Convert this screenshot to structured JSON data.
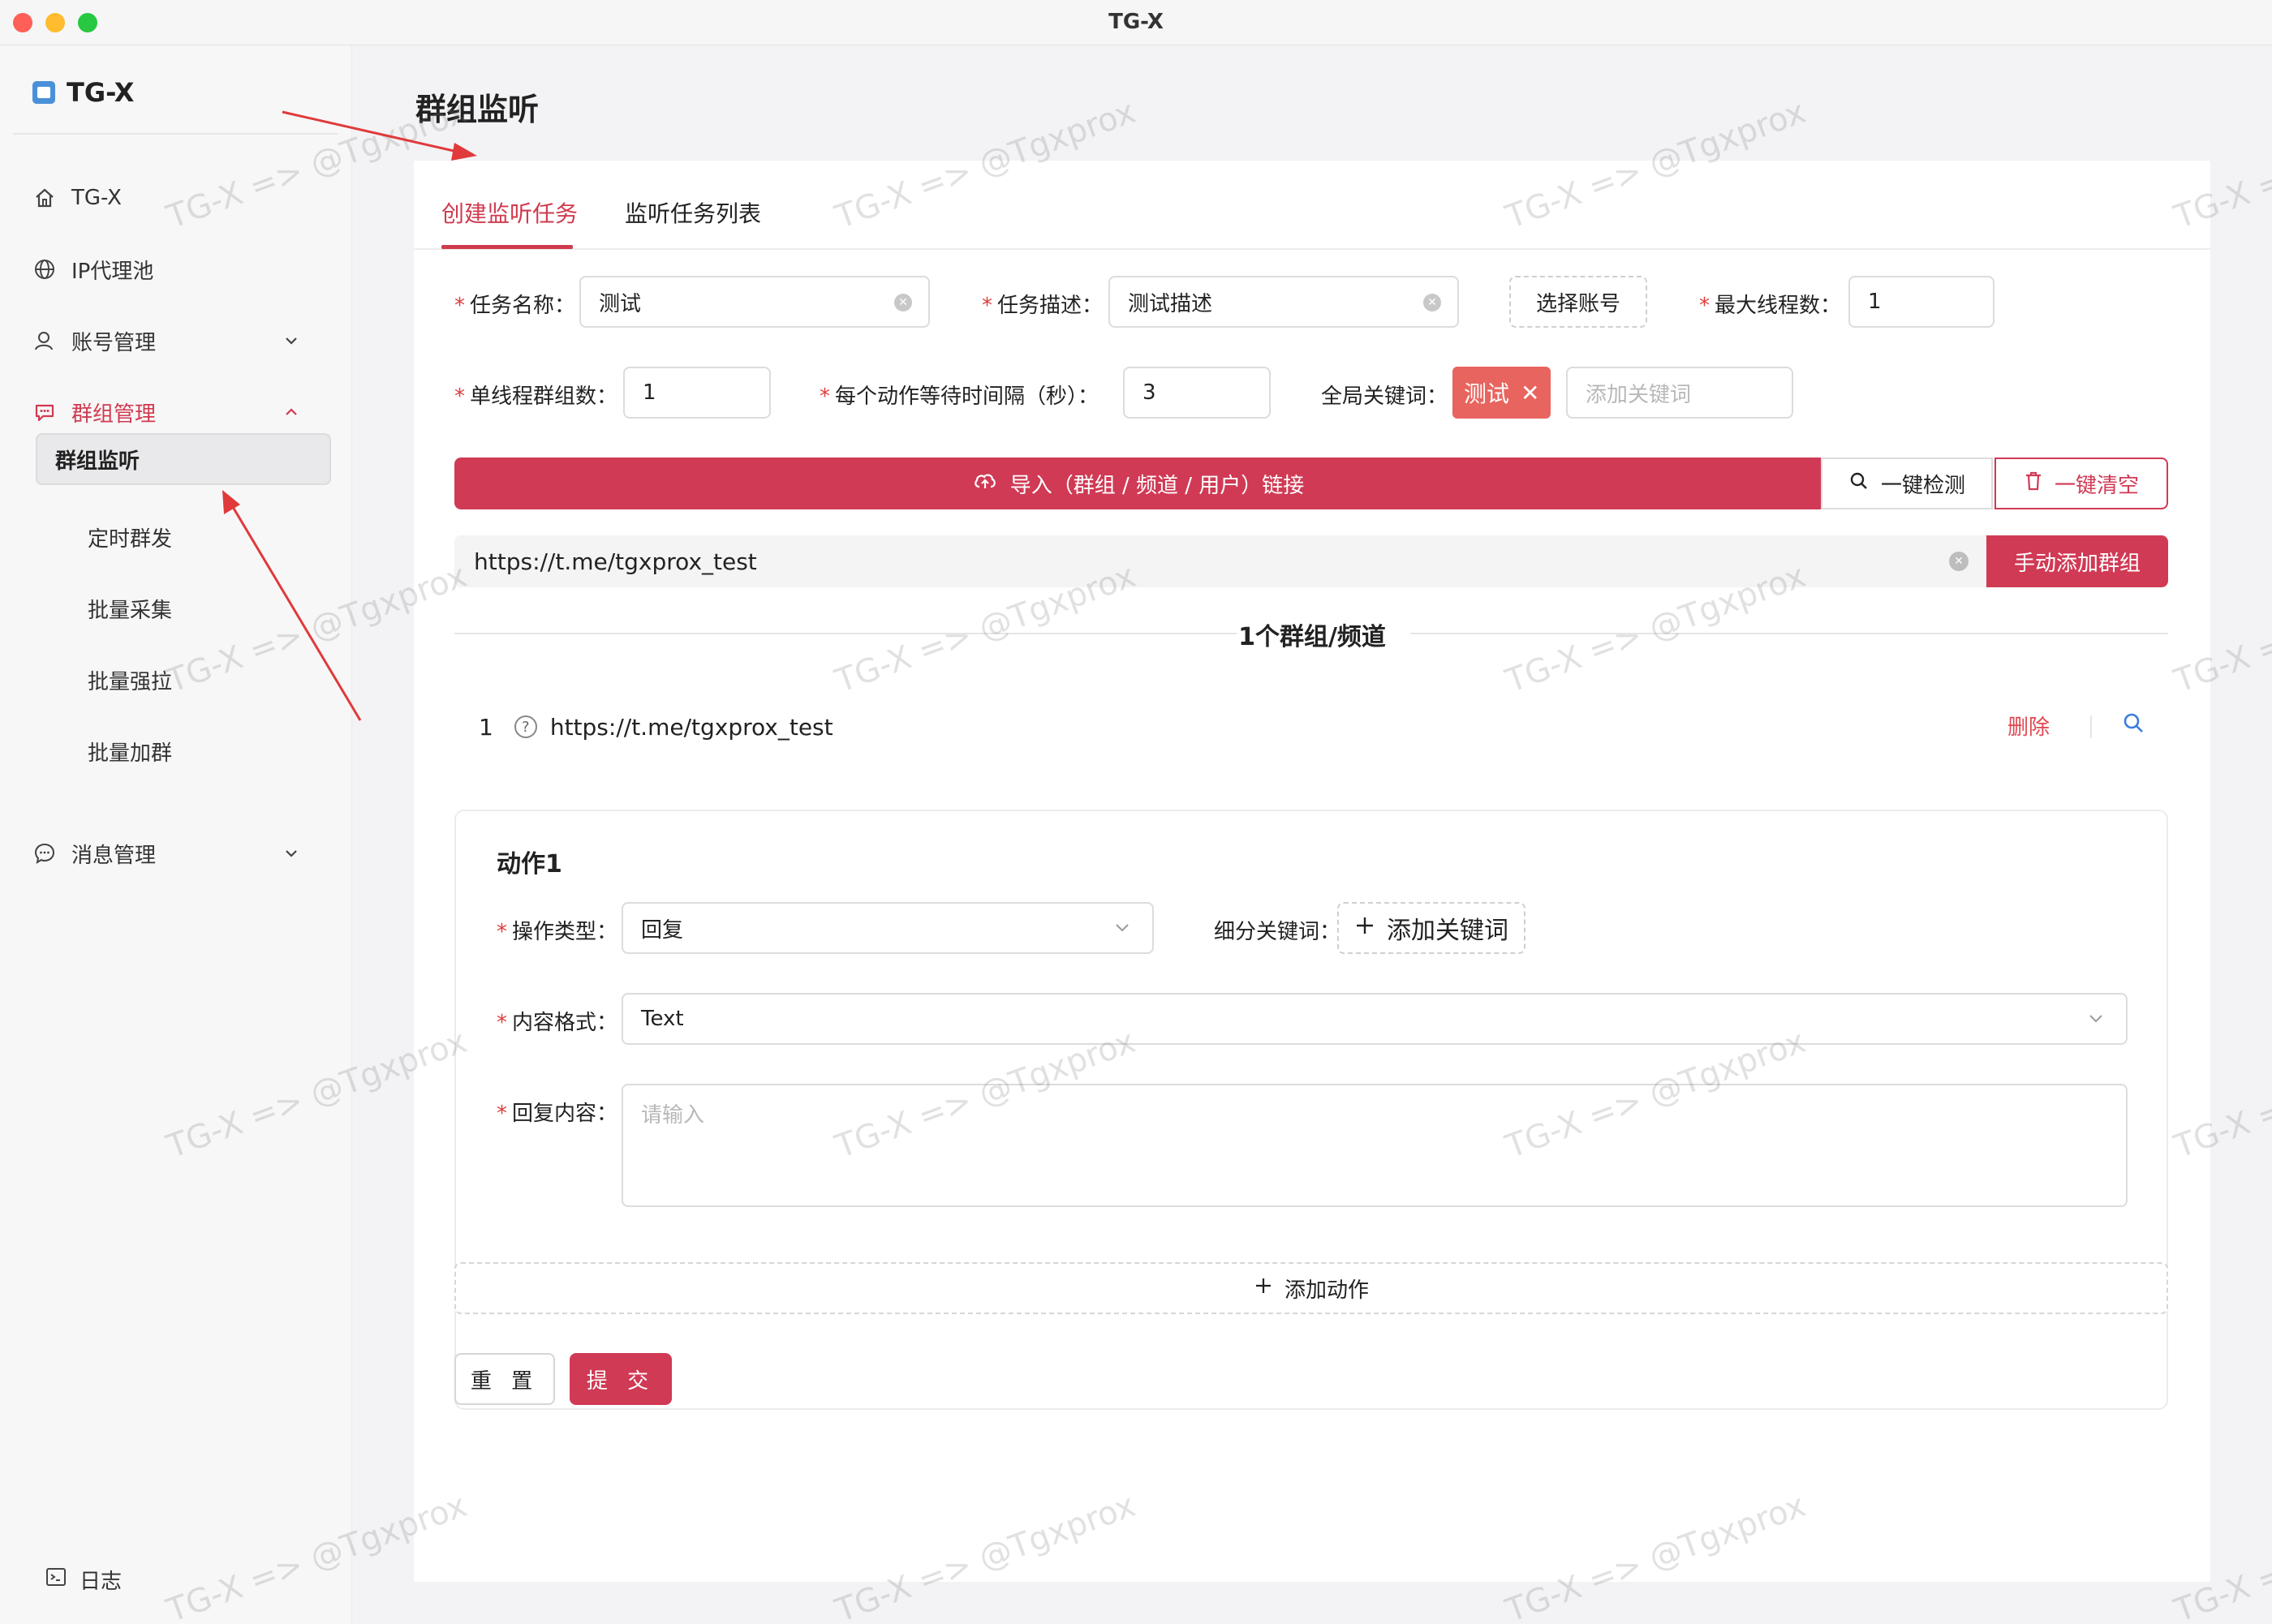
{
  "window": {
    "title": "TG-X"
  },
  "sidebar": {
    "app_name": "TG-X",
    "items": [
      {
        "label": "TG-X",
        "icon": "home-icon"
      },
      {
        "label": "IP代理池",
        "icon": "globe-icon"
      },
      {
        "label": "账号管理",
        "icon": "user-icon",
        "chevron": "down"
      },
      {
        "label": "群组管理",
        "icon": "chat-icon",
        "chevron": "up",
        "active": true
      },
      {
        "label": "消息管理",
        "icon": "message-icon",
        "chevron": "down"
      }
    ],
    "sub_items": [
      "群组监听",
      "定时群发",
      "批量采集",
      "批量强拉",
      "批量加群"
    ],
    "selected_sub": "群组监听",
    "log_label": "日志"
  },
  "page": {
    "title": "群组监听"
  },
  "tabs": [
    "创建监听任务",
    "监听任务列表"
  ],
  "form": {
    "task_name_label": "任务名称：",
    "task_name_value": "测试",
    "task_desc_label": "任务描述：",
    "task_desc_value": "测试描述",
    "select_account": "选择账号",
    "max_threads_label": "最大线程数：",
    "max_threads_value": "1",
    "groups_per_thread_label": "单线程群组数：",
    "groups_per_thread_value": "1",
    "wait_interval_label": "每个动作等待时间隔（秒）：",
    "wait_interval_value": "3",
    "global_keywords_label": "全局关键词：",
    "keyword_tag": "测试",
    "keyword_placeholder": "添加关键词",
    "import_button": "导入（群组 / 频道 / 用户）链接",
    "check_button": "一键检测",
    "clear_button": "一键清空",
    "url_value": "https://t.me/tgxprox_test",
    "add_group_button": "手动添加群组",
    "group_count": "1个群组/频道",
    "groups": [
      {
        "index": "1",
        "url": "https://t.me/tgxprox_test",
        "delete": "删除"
      }
    ]
  },
  "action": {
    "title": "动作1",
    "op_type_label": "操作类型：",
    "op_type_value": "回复",
    "sub_keywords_label": "细分关键词：",
    "add_keyword": "添加关键词",
    "content_format_label": "内容格式：",
    "content_format_value": "Text",
    "reply_content_label": "回复内容：",
    "reply_placeholder": "请输入"
  },
  "add_action": "添加动作",
  "reset_button": "重 置",
  "submit_button": "提 交",
  "watermark": "TG-X => @Tgxprox",
  "colors": {
    "accent": "#d03a55",
    "tag": "#e8645f",
    "arrow": "#e03a3a"
  }
}
